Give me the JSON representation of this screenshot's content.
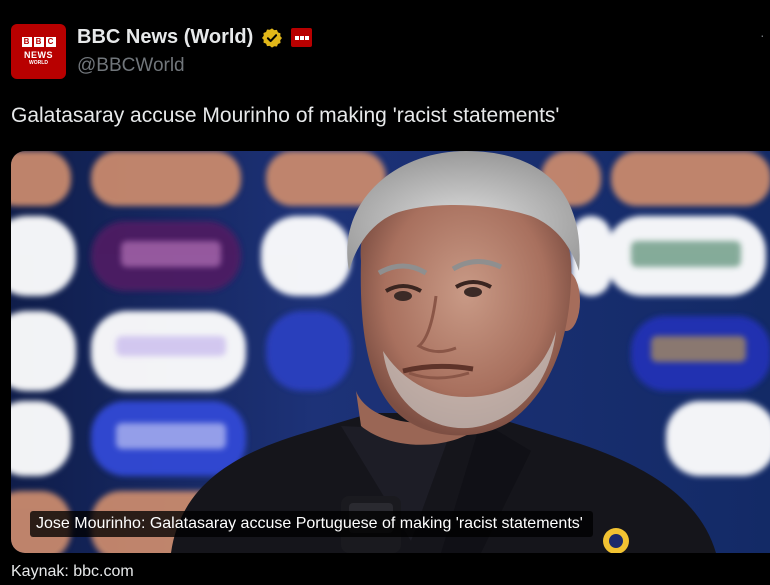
{
  "account": {
    "display_name": "BBC News (World)",
    "handle": "@BBCWorld",
    "avatar_icon": "bbc-news-world-logo-icon",
    "avatar_text": {
      "letters": [
        "B",
        "B",
        "C"
      ],
      "line1": "NEWS",
      "line2": "WORLD"
    },
    "verified_icon": "gold-verified-badge-icon",
    "affiliate_icon": "bbc-affiliate-badge-icon"
  },
  "tweet": {
    "text": "Galatasaray accuse Mourinho of making 'racist statements'",
    "media": {
      "caption": "Jose Mourinho: Galatasaray accuse Portuguese of making 'racist statements'",
      "image_icon": "press-conference-photo"
    }
  },
  "source_label": "Kaynak: bbc.com",
  "colors": {
    "background": "#000000",
    "text_primary": "#e7e9ea",
    "text_secondary": "#71767b",
    "bbc_red": "#b80000",
    "verified_gold": "#e2b719"
  }
}
